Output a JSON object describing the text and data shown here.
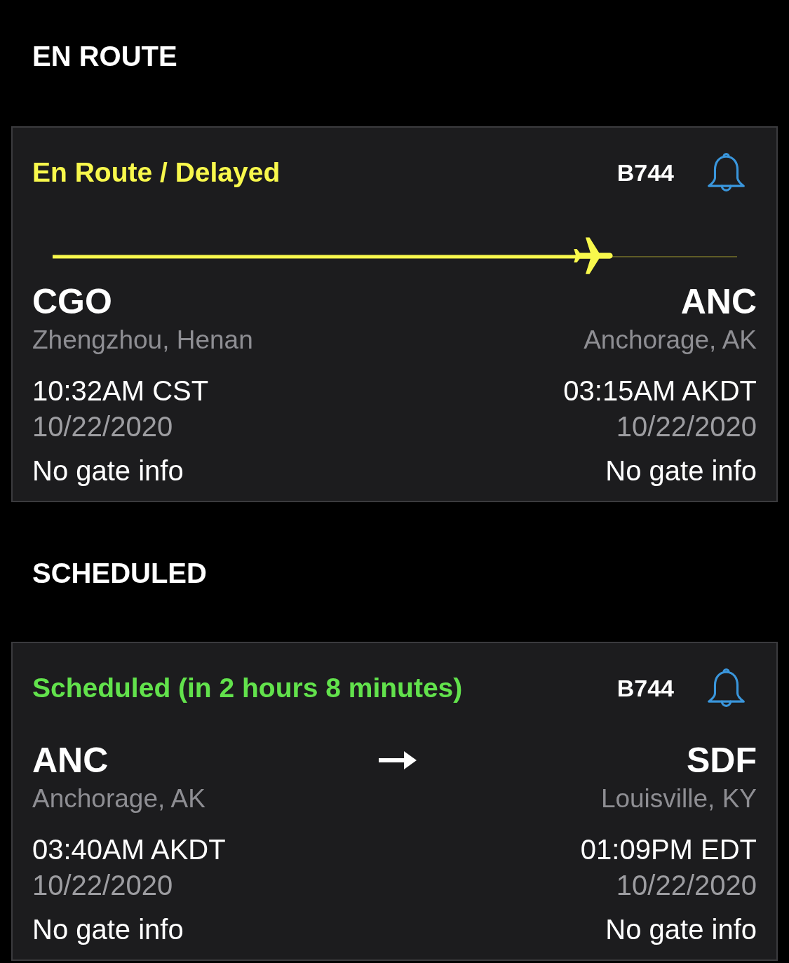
{
  "sections": [
    {
      "title": "EN ROUTE",
      "flights": [
        {
          "kind": "en_route",
          "status": "En Route / Delayed",
          "color": "#f8f84c",
          "aircraft": "B744",
          "level": 0.79,
          "origin": {
            "code": "CGO",
            "city": "Zhengzhou, Henan",
            "time": "10:32AM CST",
            "date": "10/22/2020",
            "gate": "No gate info"
          },
          "destination": {
            "code": "ANC",
            "city": "Anchorage, AK",
            "time": "03:15AM AKDT",
            "date": "10/22/2020",
            "gate": "No gate info"
          }
        }
      ]
    },
    {
      "title": "SCHEDULED",
      "flights": [
        {
          "kind": "scheduled",
          "status": "Scheduled (in 2 hours 8 minutes)",
          "color": "#62e24c",
          "aircraft": "B744",
          "origin": {
            "code": "ANC",
            "city": "Anchorage, AK",
            "time": "03:40AM AKDT",
            "date": "10/22/2020",
            "gate": "No gate info"
          },
          "destination": {
            "code": "SDF",
            "city": "Louisville, KY",
            "time": "01:09PM EDT",
            "date": "10/22/2020",
            "gate": "No gate info"
          }
        }
      ]
    }
  ]
}
